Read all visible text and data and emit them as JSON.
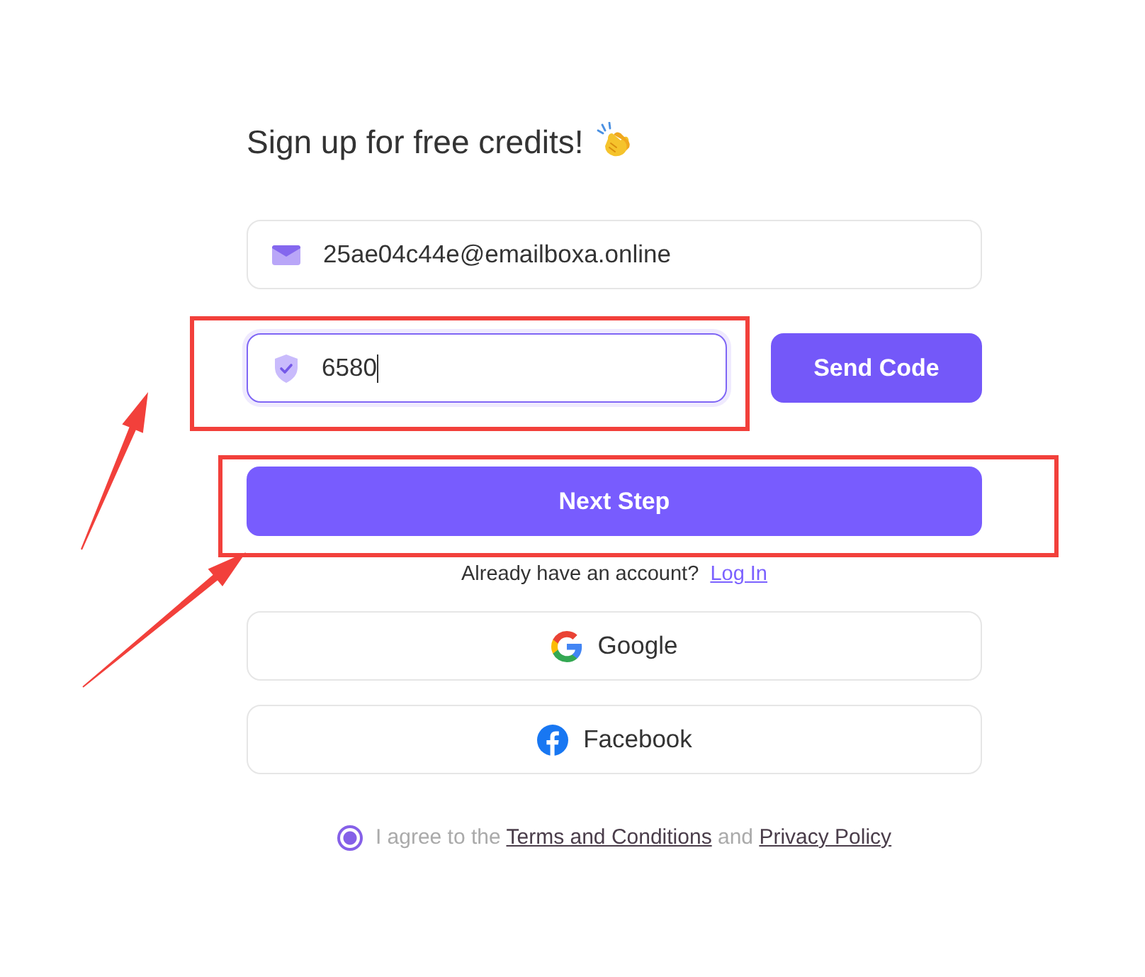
{
  "heading": {
    "text": "Sign up for free credits!"
  },
  "email_field": {
    "value": "25ae04c44e@emailboxa.online"
  },
  "code_field": {
    "value": "6580",
    "focused": true
  },
  "send_code_button": {
    "label": "Send Code"
  },
  "next_step_button": {
    "label": "Next Step"
  },
  "login_prompt": {
    "text": "Already have an account?",
    "link": "Log In"
  },
  "social_buttons": [
    {
      "kind": "google",
      "label": "Google"
    },
    {
      "kind": "facebook",
      "label": "Facebook"
    }
  ],
  "agreement": {
    "checked": true,
    "segments": [
      {
        "kind": "text",
        "text": "I agree to the"
      },
      {
        "kind": "link",
        "text": "Terms and Conditions"
      },
      {
        "kind": "text",
        "text": "and"
      },
      {
        "kind": "link",
        "text": "Privacy Policy"
      }
    ]
  },
  "annotations": [
    {
      "kind": "frame"
    },
    {
      "kind": "frame"
    },
    {
      "kind": "arrow"
    },
    {
      "kind": "arrow"
    }
  ]
}
